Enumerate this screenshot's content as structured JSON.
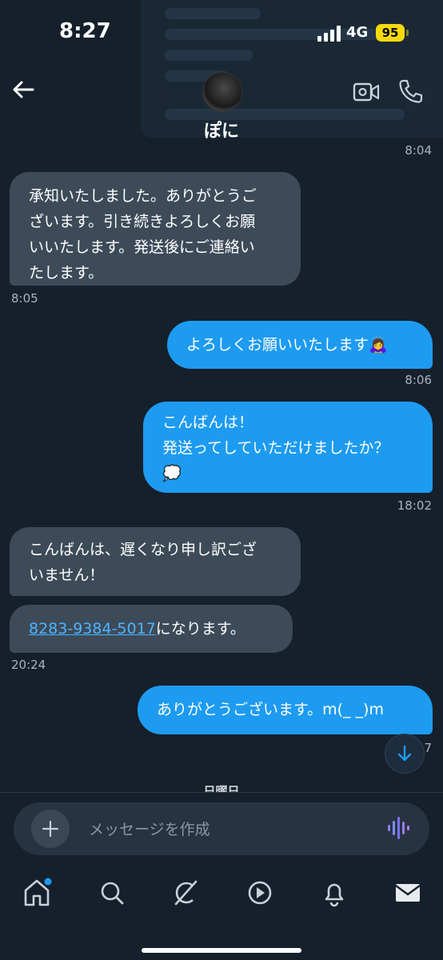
{
  "status_bar": {
    "time": "8:27",
    "network": "4G",
    "battery": "95"
  },
  "header": {
    "contact_name": "ぽに"
  },
  "messages": [
    {
      "direction": "in",
      "lines": [
        "承知いたしました。ありがとうご",
        "ざいます。引き続きよろしくお願",
        "いいたします。発送後にご連絡い",
        "たします。"
      ],
      "time": "8:05"
    },
    {
      "direction": "out",
      "lines": [
        "よろしくお願いいたします🙇‍♀️"
      ],
      "time": "8:06"
    },
    {
      "direction": "out",
      "lines": [
        "こんばんは！",
        "発送ってしていただけましたか？",
        "💭"
      ],
      "time": "18:02"
    },
    {
      "direction": "in",
      "lines": [
        "こんばんは、遅くなり申し訳ござ",
        "いません！"
      ]
    },
    {
      "direction": "in",
      "link": "8283-9384-5017",
      "suffix": "になります。",
      "time": "20:24"
    },
    {
      "direction": "out",
      "lines": [
        "ありがとうございます。m(_ _)m"
      ]
    }
  ],
  "top_timestamp": "8:04",
  "partial_time_under_button": "7",
  "day_separator": "日曜日",
  "composer": {
    "placeholder": "メッセージを作成"
  },
  "tab_bar": [
    "home-icon",
    "search-icon",
    "grok-icon",
    "video-icon",
    "notifications-icon",
    "messages-icon"
  ],
  "colors": {
    "background": "#15202b",
    "outgoing_bubble": "#1d9bf0",
    "incoming_bubble": "#3d4b59",
    "link": "#4db3ff",
    "notification_dot": "#1d9bf0"
  }
}
